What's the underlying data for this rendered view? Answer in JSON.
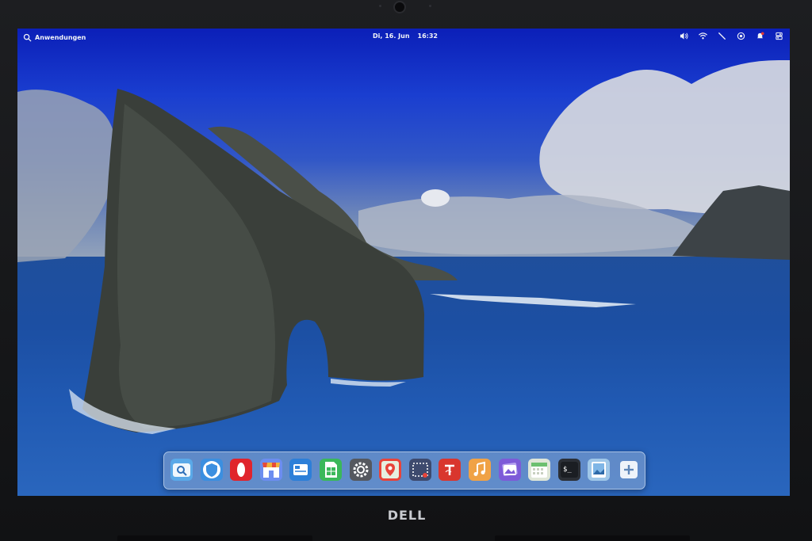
{
  "topbar": {
    "activities_label": "Anwendungen",
    "date": "Di, 16. Jun",
    "time": "16:32",
    "status_icons": [
      "volume-icon",
      "wifi-icon",
      "network-icon",
      "privacy-icon",
      "notification-icon",
      "power-icon"
    ]
  },
  "dock": {
    "items": [
      {
        "name": "finder",
        "icon": "search-folder-icon",
        "color": "#5aa9e8"
      },
      {
        "name": "browser",
        "icon": "shield-browser-icon",
        "color": "#3b8fe0"
      },
      {
        "name": "opera",
        "icon": "opera-icon",
        "color": "#e0242c"
      },
      {
        "name": "app-store",
        "icon": "store-icon",
        "color": "#6c8df0"
      },
      {
        "name": "mail",
        "icon": "mail-icon",
        "color": "#2d7fd8"
      },
      {
        "name": "spreadsheet",
        "icon": "spreadsheet-icon",
        "color": "#3ab85a"
      },
      {
        "name": "settings",
        "icon": "gear-icon",
        "color": "#55585f"
      },
      {
        "name": "maps",
        "icon": "map-pin-icon",
        "color": "#e8443a"
      },
      {
        "name": "screenshot",
        "icon": "screenshot-icon",
        "color": "#3e4a6e"
      },
      {
        "name": "text-editor",
        "icon": "text-editor-icon",
        "color": "#d9362e"
      },
      {
        "name": "music",
        "icon": "music-note-icon",
        "color": "#f0a246"
      },
      {
        "name": "photos",
        "icon": "photos-icon",
        "color": "#7d5bd8"
      },
      {
        "name": "calendar",
        "icon": "calendar-icon",
        "color": "#dfe6d8"
      },
      {
        "name": "terminal",
        "icon": "terminal-icon",
        "color": "#2b2f36"
      },
      {
        "name": "image-viewer",
        "icon": "image-icon",
        "color": "#9fc7e8"
      },
      {
        "name": "add",
        "icon": "plus-icon",
        "color": "#e6edf7"
      }
    ]
  },
  "brand": {
    "text": "DELL"
  }
}
